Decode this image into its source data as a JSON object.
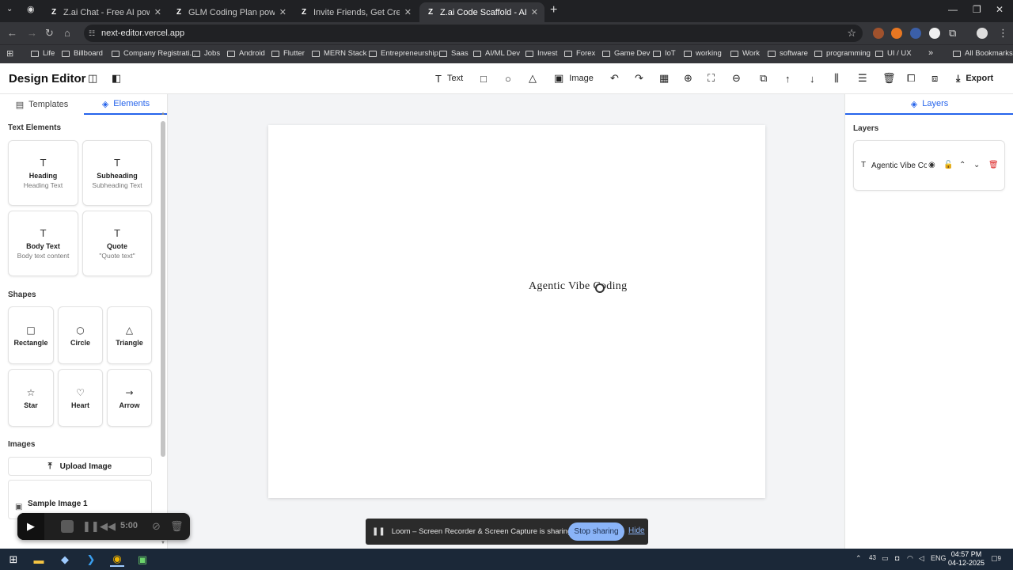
{
  "browser": {
    "tabs": [
      {
        "label": "Z.ai Chat - Free AI powered by",
        "fav": "Z",
        "active": false
      },
      {
        "label": "GLM Coding Plan powered by",
        "fav": "Z",
        "active": false
      },
      {
        "label": "Invite Friends, Get Credits - Z.AI",
        "fav": "Z",
        "active": false
      },
      {
        "label": "Z.ai Code Scaffold - AI-Powered",
        "fav": "Z",
        "active": true
      }
    ],
    "url": "next-editor.vercel.app",
    "bookmarks": [
      "Life",
      "Billboard",
      "Company Registrati...",
      "Jobs",
      "Android",
      "Flutter",
      "MERN Stack",
      "Entrepreneurship",
      "Saas",
      "AI/ML Dev",
      "Invest",
      "Forex",
      "Game Dev",
      "IoT",
      "working",
      "Work",
      "software",
      "programming",
      "UI / UX"
    ],
    "all_bookmarks": "All Bookmarks"
  },
  "app": {
    "title": "Design Editor",
    "toolbar": {
      "text_label": "Text",
      "image_label": "Image",
      "export_label": "Export"
    }
  },
  "left_panel": {
    "tabs": [
      {
        "label": "Templates",
        "active": false
      },
      {
        "label": "Elements",
        "active": true
      }
    ],
    "text_elements_title": "Text Elements",
    "text_elements": [
      {
        "name": "Heading",
        "sub": "Heading Text"
      },
      {
        "name": "Subheading",
        "sub": "Subheading Text"
      },
      {
        "name": "Body Text",
        "sub": "Body text content"
      },
      {
        "name": "Quote",
        "sub": "\"Quote text\""
      }
    ],
    "shapes_title": "Shapes",
    "shapes": [
      {
        "name": "Rectangle",
        "icon": "rectangle-icon",
        "glyph": "□"
      },
      {
        "name": "Circle",
        "icon": "circle-icon",
        "glyph": "○"
      },
      {
        "name": "Triangle",
        "icon": "triangle-icon",
        "glyph": "△"
      },
      {
        "name": "Star",
        "icon": "star-icon",
        "glyph": "☆"
      },
      {
        "name": "Heart",
        "icon": "heart-icon",
        "glyph": "♡"
      },
      {
        "name": "Arrow",
        "icon": "arrow-icon",
        "glyph": "→"
      }
    ],
    "images_title": "Images",
    "upload_label": "Upload Image",
    "sample_image_label": "Sample Image 1"
  },
  "canvas": {
    "text": "Agentic Vibe Coding"
  },
  "right_panel": {
    "tab_label": "Layers",
    "layers_title": "Layers",
    "layers": [
      {
        "name": "Agentic Vibe Coding",
        "type_icon": "T"
      }
    ]
  },
  "loom": {
    "timer": "5:00",
    "message": "Loom – Screen Recorder & Screen Capture is sharing your screen.",
    "stop_label": "Stop sharing",
    "hide_label": "Hide"
  },
  "taskbar": {
    "language": "ENG",
    "battery": "43",
    "time": "04:57 PM",
    "date": "04-12-2025",
    "notifications": "9"
  },
  "colors": {
    "accent": "#2563eb",
    "chrome_dark": "#202124",
    "chrome_mid": "#35363a",
    "loom_button": "#8ab4f8",
    "delete_red": "#dc2626"
  }
}
